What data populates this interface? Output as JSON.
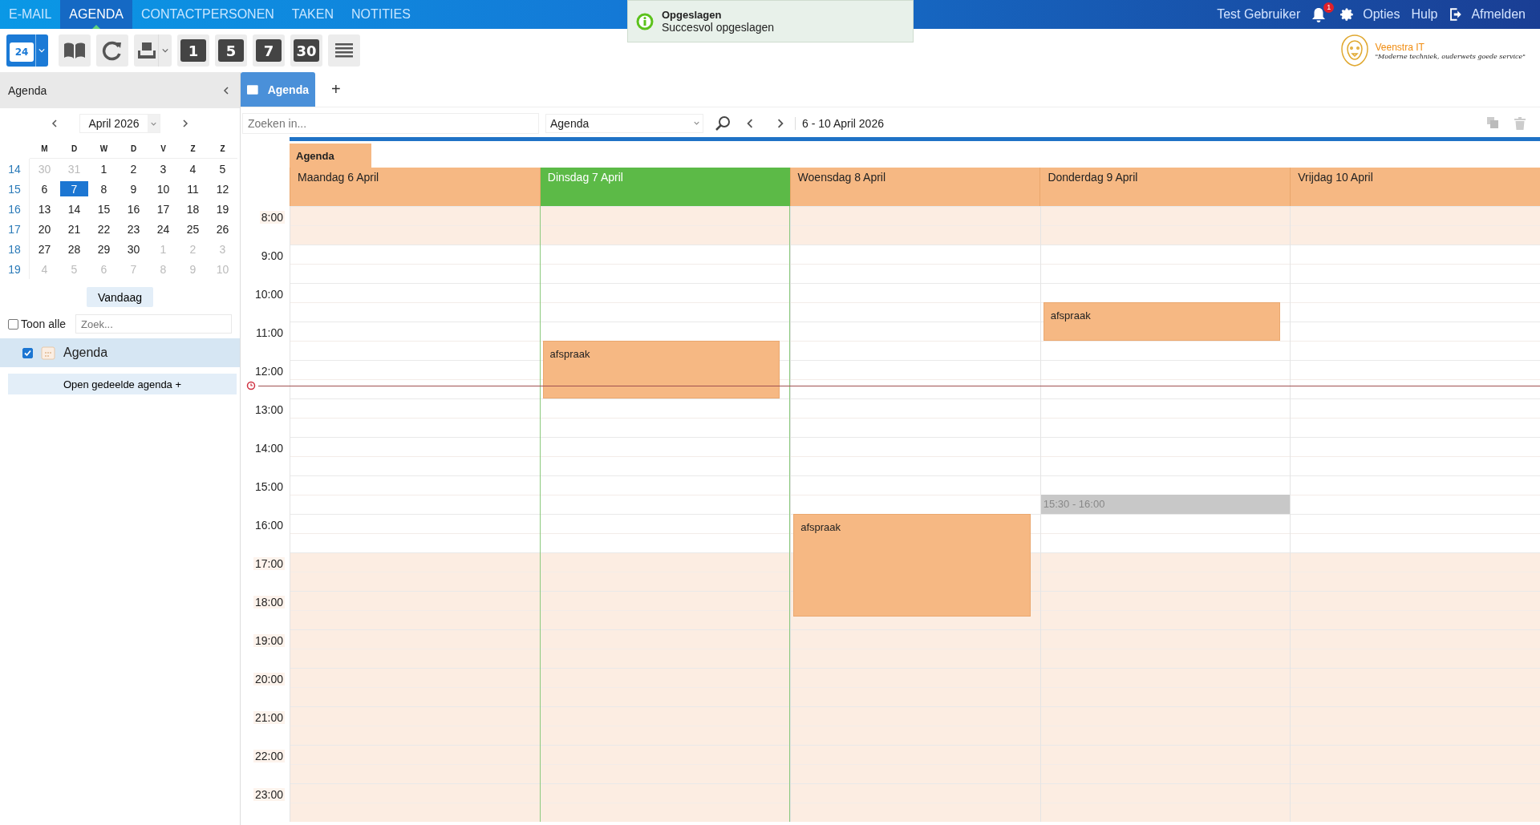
{
  "nav": {
    "tabs": [
      {
        "label": "E-MAIL",
        "selected": false
      },
      {
        "label": "AGENDA",
        "selected": true
      },
      {
        "label": "CONTACTPERSONEN",
        "selected": false
      },
      {
        "label": "TAKEN",
        "selected": false
      },
      {
        "label": "NOTITIES",
        "selected": false
      }
    ],
    "user": "Test Gebruiker",
    "notification_count": "1",
    "links": [
      {
        "kind": "options",
        "label": "Opties"
      },
      {
        "kind": "help",
        "label": "Hulp"
      },
      {
        "kind": "logout",
        "label": "Afmelden"
      }
    ]
  },
  "toast": {
    "title": "Opgeslagen",
    "message": "Succesvol opgeslagen"
  },
  "toolbar": {
    "buttons": [
      {
        "kind": "new",
        "label": "24",
        "dropdown": true
      },
      {
        "kind": "book",
        "dropdown": false
      },
      {
        "kind": "refresh",
        "dropdown": false
      },
      {
        "kind": "print",
        "dropdown": true
      },
      {
        "kind": "view",
        "label": "1",
        "dropdown": false
      },
      {
        "kind": "view",
        "label": "5",
        "dropdown": false
      },
      {
        "kind": "view",
        "label": "7",
        "dropdown": false
      },
      {
        "kind": "view",
        "label": "30",
        "dropdown": false
      },
      {
        "kind": "list",
        "dropdown": false
      }
    ]
  },
  "logo": {
    "name": "Veenstra IT",
    "tagline": "\"Moderne techniek, ouderwets goede service\""
  },
  "sidebar": {
    "title": "Agenda",
    "month": "April 2026",
    "weekdays": [
      "M",
      "D",
      "W",
      "D",
      "V",
      "Z",
      "Z"
    ],
    "weeks": [
      {
        "week": "14",
        "days": [
          {
            "label": "30",
            "muted": true,
            "selected": false
          },
          {
            "label": "31",
            "muted": true,
            "selected": false
          },
          {
            "label": "1",
            "muted": false,
            "selected": false
          },
          {
            "label": "2",
            "muted": false,
            "selected": false
          },
          {
            "label": "3",
            "muted": false,
            "selected": false
          },
          {
            "label": "4",
            "muted": false,
            "selected": false
          },
          {
            "label": "5",
            "muted": false,
            "selected": false
          }
        ]
      },
      {
        "week": "15",
        "days": [
          {
            "label": "6",
            "muted": false,
            "selected": false
          },
          {
            "label": "7",
            "muted": false,
            "selected": true
          },
          {
            "label": "8",
            "muted": false,
            "selected": false
          },
          {
            "label": "9",
            "muted": false,
            "selected": false
          },
          {
            "label": "10",
            "muted": false,
            "selected": false
          },
          {
            "label": "11",
            "muted": false,
            "selected": false
          },
          {
            "label": "12",
            "muted": false,
            "selected": false
          }
        ]
      },
      {
        "week": "16",
        "days": [
          {
            "label": "13",
            "muted": false,
            "selected": false
          },
          {
            "label": "14",
            "muted": false,
            "selected": false
          },
          {
            "label": "15",
            "muted": false,
            "selected": false
          },
          {
            "label": "16",
            "muted": false,
            "selected": false
          },
          {
            "label": "17",
            "muted": false,
            "selected": false
          },
          {
            "label": "18",
            "muted": false,
            "selected": false
          },
          {
            "label": "19",
            "muted": false,
            "selected": false
          }
        ]
      },
      {
        "week": "17",
        "days": [
          {
            "label": "20",
            "muted": false,
            "selected": false
          },
          {
            "label": "21",
            "muted": false,
            "selected": false
          },
          {
            "label": "22",
            "muted": false,
            "selected": false
          },
          {
            "label": "23",
            "muted": false,
            "selected": false
          },
          {
            "label": "24",
            "muted": false,
            "selected": false
          },
          {
            "label": "25",
            "muted": false,
            "selected": false
          },
          {
            "label": "26",
            "muted": false,
            "selected": false
          }
        ]
      },
      {
        "week": "18",
        "days": [
          {
            "label": "27",
            "muted": false,
            "selected": false
          },
          {
            "label": "28",
            "muted": false,
            "selected": false
          },
          {
            "label": "29",
            "muted": false,
            "selected": false
          },
          {
            "label": "30",
            "muted": false,
            "selected": false
          },
          {
            "label": "1",
            "muted": true,
            "selected": false
          },
          {
            "label": "2",
            "muted": true,
            "selected": false
          },
          {
            "label": "3",
            "muted": true,
            "selected": false
          }
        ]
      },
      {
        "week": "19",
        "days": [
          {
            "label": "4",
            "muted": true,
            "selected": false
          },
          {
            "label": "5",
            "muted": true,
            "selected": false
          },
          {
            "label": "6",
            "muted": true,
            "selected": false
          },
          {
            "label": "7",
            "muted": true,
            "selected": false
          },
          {
            "label": "8",
            "muted": true,
            "selected": false
          },
          {
            "label": "9",
            "muted": true,
            "selected": false
          },
          {
            "label": "10",
            "muted": true,
            "selected": false
          }
        ]
      }
    ],
    "today_button": "Vandaag",
    "show_all": {
      "label": "Toon alle",
      "checked": false
    },
    "filter": {
      "placeholder": "Zoek..."
    },
    "calendars": [
      {
        "label": "Agenda",
        "checked": true,
        "selected": true
      }
    ],
    "open_shared": "Open gedeelde agenda +"
  },
  "main": {
    "tabs": [
      {
        "label": "Agenda",
        "selected": true
      }
    ],
    "add_tab": "+",
    "search": {
      "placeholder": "Zoeken in..."
    },
    "scope": "Agenda",
    "range": "6 - 10 April 2026",
    "group": "Agenda",
    "days": [
      {
        "label": "Maandag 6 April",
        "selected": false
      },
      {
        "label": "Dinsdag 7 April",
        "selected": true,
        "events": [
          {
            "kind": "appointment",
            "label": "afspraak"
          }
        ]
      },
      {
        "label": "Woensdag 8 April",
        "selected": false,
        "events": [
          {
            "kind": "appointment",
            "label": "afspraak"
          }
        ]
      },
      {
        "label": "Donderdag 9 April",
        "selected": false,
        "events": [
          {
            "kind": "appointment",
            "label": "afspraak"
          },
          {
            "kind": "busy",
            "label": "15:30 - 16:00"
          }
        ]
      },
      {
        "label": "Vrijdag 10 April",
        "selected": false
      }
    ],
    "hours": [
      {
        "label": "8:00",
        "working": false
      },
      {
        "label": "9:00",
        "working": true
      },
      {
        "label": "10:00",
        "working": true
      },
      {
        "label": "11:00",
        "working": true
      },
      {
        "label": "12:00",
        "working": true
      },
      {
        "label": "13:00",
        "working": true
      },
      {
        "label": "14:00",
        "working": true
      },
      {
        "label": "15:00",
        "working": true
      },
      {
        "label": "16:00",
        "working": true
      },
      {
        "label": "17:00",
        "working": false
      },
      {
        "label": "18:00",
        "working": false
      },
      {
        "label": "19:00",
        "working": false
      },
      {
        "label": "20:00",
        "working": false
      },
      {
        "label": "21:00",
        "working": false
      },
      {
        "label": "22:00",
        "working": false
      },
      {
        "label": "23:00",
        "working": false
      }
    ]
  }
}
